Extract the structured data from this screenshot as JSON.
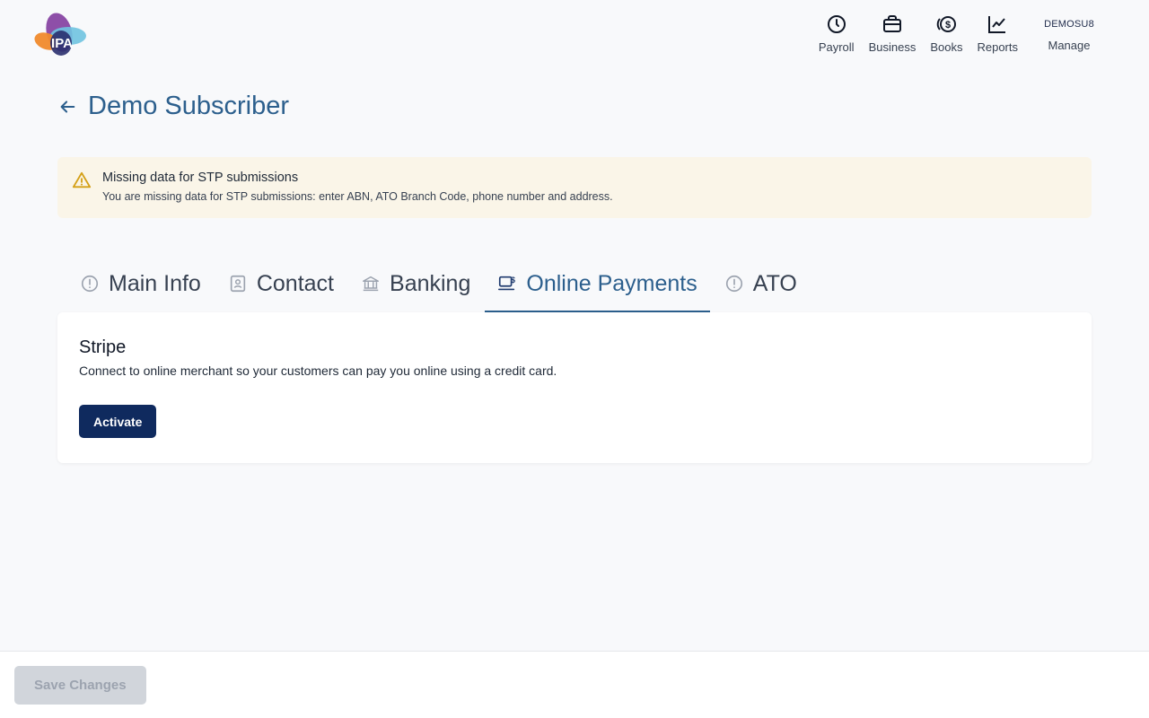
{
  "header": {
    "logo_text": "IPA",
    "nav": [
      {
        "label": "Payroll",
        "icon": "clock-icon"
      },
      {
        "label": "Business",
        "icon": "briefcase-icon"
      },
      {
        "label": "Books",
        "icon": "dollar-coins-icon"
      },
      {
        "label": "Reports",
        "icon": "trend-chart-icon"
      }
    ],
    "user_code": "DEMOSU8",
    "manage_label": "Manage"
  },
  "page": {
    "title": "Demo Subscriber"
  },
  "alert": {
    "title": "Missing data for STP submissions",
    "text": "You are missing data for STP submissions: enter ABN, ATO Branch Code, phone number and address."
  },
  "tabs": [
    {
      "label": "Main Info",
      "icon": "alert-circle-icon",
      "active": false
    },
    {
      "label": "Contact",
      "icon": "contact-card-icon",
      "active": false
    },
    {
      "label": "Banking",
      "icon": "bank-icon",
      "active": false
    },
    {
      "label": "Online Payments",
      "icon": "online-payment-icon",
      "active": true
    },
    {
      "label": "ATO",
      "icon": "alert-circle-icon",
      "active": false
    }
  ],
  "stripe": {
    "title": "Stripe",
    "description": "Connect to online merchant so your customers can pay you online using a credit card.",
    "activate_label": "Activate"
  },
  "footer": {
    "save_label": "Save Changes"
  },
  "colors": {
    "accent": "#2c5f8d",
    "primary_button": "#0f2a5e",
    "alert_bg": "#faf5e8",
    "warning_icon": "#d4a017"
  }
}
